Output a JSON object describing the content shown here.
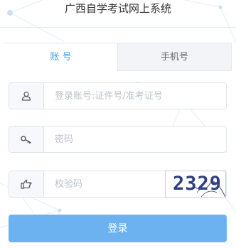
{
  "app": {
    "title": "广西自学考试网上系统"
  },
  "tabs": [
    {
      "label": "账 号",
      "active": true
    },
    {
      "label": "手机号",
      "active": false
    }
  ],
  "form": {
    "account": {
      "placeholder": "登录账号:证件号/准考证号",
      "icon": "user-icon"
    },
    "password": {
      "placeholder": "密码",
      "icon": "key-icon"
    },
    "captcha": {
      "placeholder": "校验码",
      "icon": "hand-pointer-icon",
      "image_text": "2329"
    },
    "submit_label": "登录"
  },
  "colors": {
    "accent": "#4aa3e9",
    "button": "#6db2f0"
  }
}
